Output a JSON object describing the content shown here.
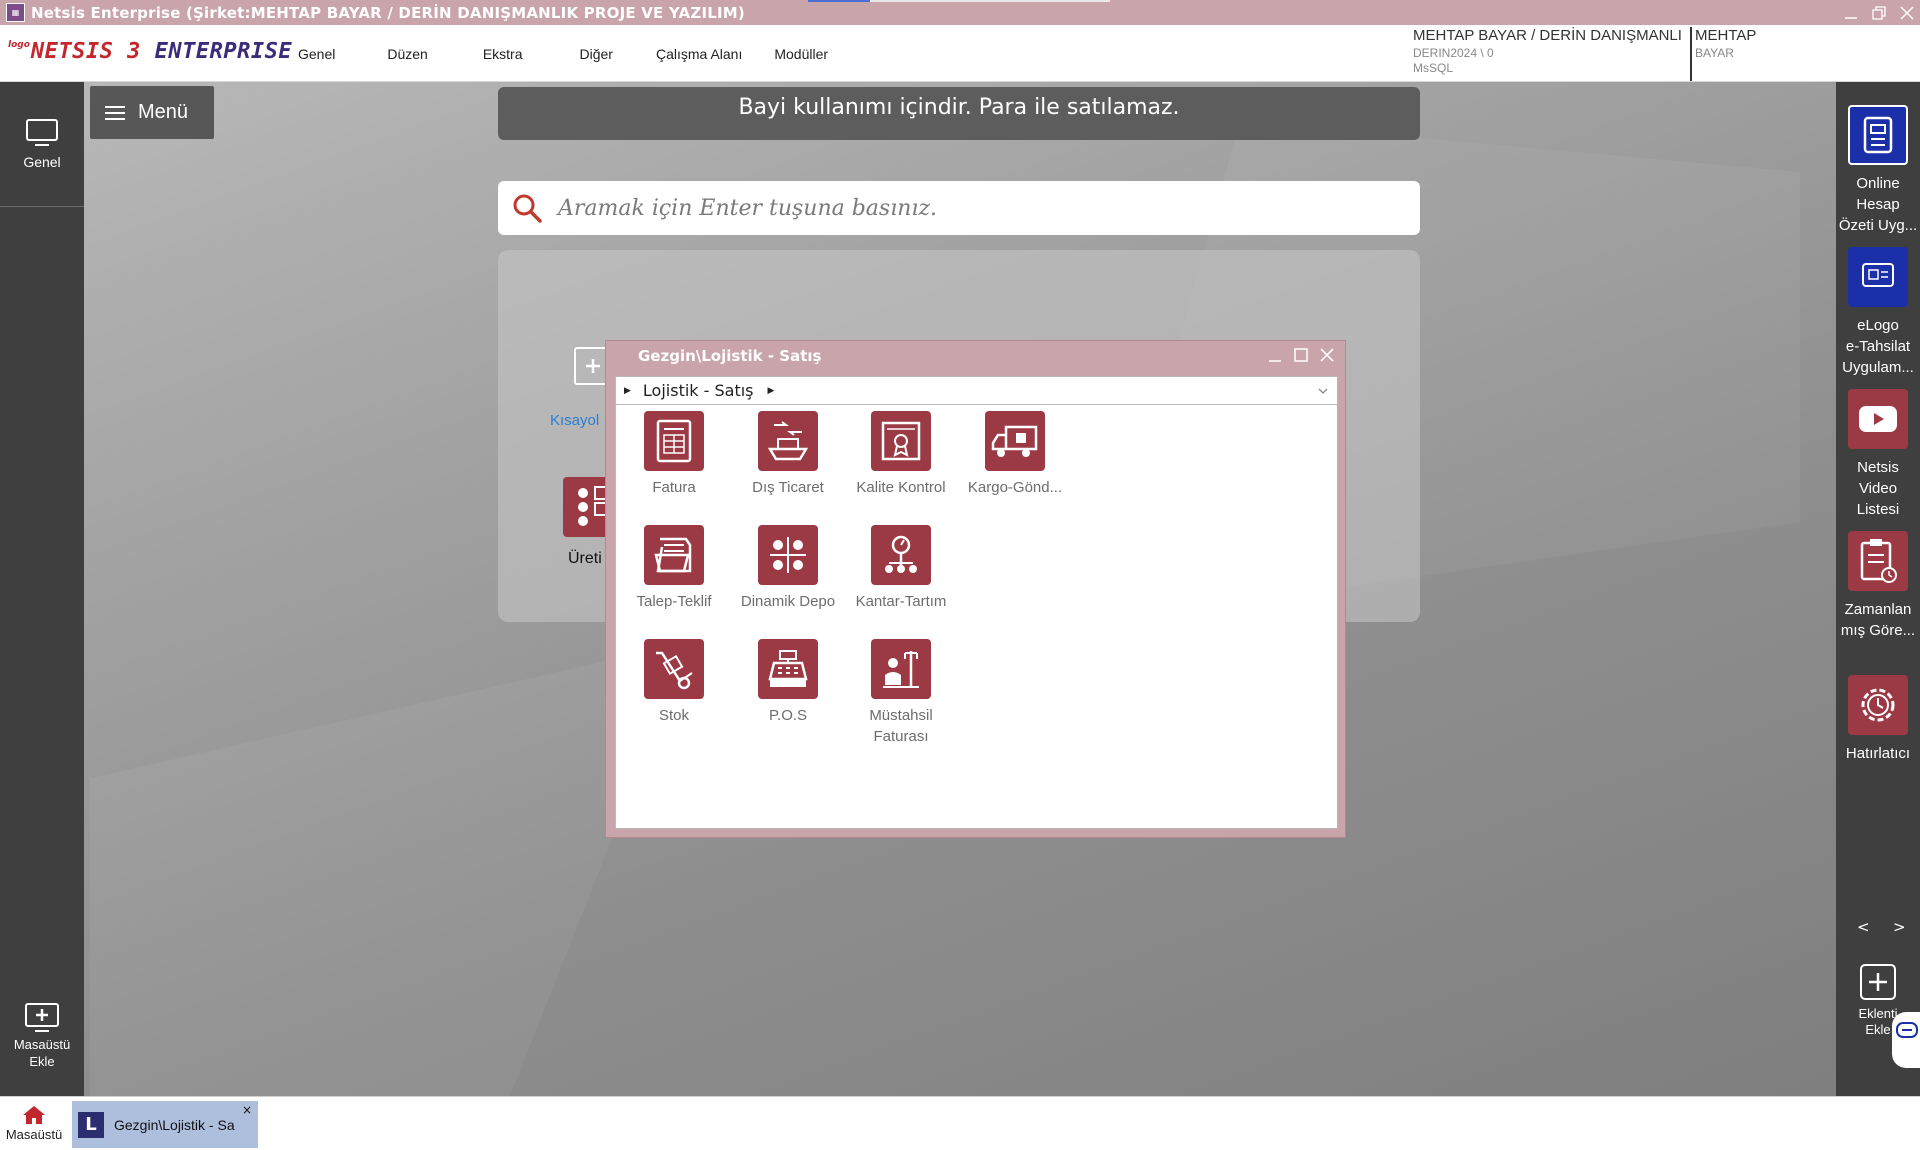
{
  "titlebar": {
    "title": "Netsis Enterprise (Şirket:MEHTAP BAYAR / DERİN DANIŞMANLIK PROJE VE YAZILIM)"
  },
  "header": {
    "logo_small": "logo",
    "logo_main_a": "NETSIS 3 ",
    "logo_main_b": "ENTERPRISE",
    "menu": [
      "Genel",
      "Düzen",
      "Ekstra",
      "Diğer",
      "Çalışma Alanı",
      "Modüller"
    ],
    "company": "MEHTAP BAYAR / DERİN DANIŞMANLI",
    "db": "DERIN2024 \\ 0",
    "server": "MsSQL",
    "user_name": "MEHTAP",
    "user_surname": "BAYAR"
  },
  "left_bar": {
    "genel_label": "Genel",
    "add_desktop_line1": "Masaüstü",
    "add_desktop_line2": "Ekle"
  },
  "desktop": {
    "menu_label": "Menü",
    "banner": "Bayi kullanımı içindir. Para ile satılamaz.",
    "search_placeholder": "Aramak için Enter tuşuna basınız.",
    "shortcut_label": "Kısayol",
    "production_label": "Üreti"
  },
  "right_bar": {
    "items": [
      {
        "lines": [
          "Online",
          "Hesap",
          "Özeti Uyg..."
        ],
        "color": "#1a2fa8"
      },
      {
        "lines": [
          "eLogo",
          "e-Tahsilat",
          "Uygulam..."
        ],
        "color": "#1a2fa8"
      },
      {
        "lines": [
          "Netsis",
          "Video",
          "Listesi"
        ],
        "color": "#9b3a44"
      },
      {
        "lines": [
          "Zamanlan",
          "mış Göre..."
        ],
        "color": "#9b3a44"
      },
      {
        "lines": [
          "Hatırlatıcı"
        ],
        "color": "#9b3a44"
      }
    ],
    "prev": "<",
    "next": ">",
    "add_plugin_line1": "Eklenti",
    "add_plugin_line2": "Ekle"
  },
  "window": {
    "title": "Gezgin\\Lojistik - Satış",
    "breadcrumb": "Lojistik - Satış",
    "tiles": [
      {
        "label": "Fatura",
        "icon": "invoice-icon"
      },
      {
        "label": "Dış Ticaret",
        "icon": "ship-icon"
      },
      {
        "label": "Kalite Kontrol",
        "icon": "certificate-icon"
      },
      {
        "label": "Kargo-Gönd...",
        "icon": "truck-icon"
      },
      {
        "label": "Talep-Teklif",
        "icon": "folder-icon"
      },
      {
        "label": "Dinamik Depo",
        "icon": "warehouse-grid-icon"
      },
      {
        "label": "Kantar-Tartım",
        "icon": "scale-icon"
      },
      {
        "label": "Stok",
        "icon": "hand-truck-icon"
      },
      {
        "label": "P.O.S",
        "icon": "cash-register-icon"
      },
      {
        "label": "Müstahsil",
        "label2": "Faturası",
        "icon": "farmer-icon"
      }
    ]
  },
  "taskbar": {
    "home_label": "Masaüstü",
    "tab_label": "Gezgin\\Lojistik - Sa",
    "tab_icon_letter": "L",
    "tab_close": "×"
  },
  "colors": {
    "accent": "#9b3a44",
    "titlebar": "#c9a4aa",
    "blue_tile": "#1a2fa8"
  }
}
